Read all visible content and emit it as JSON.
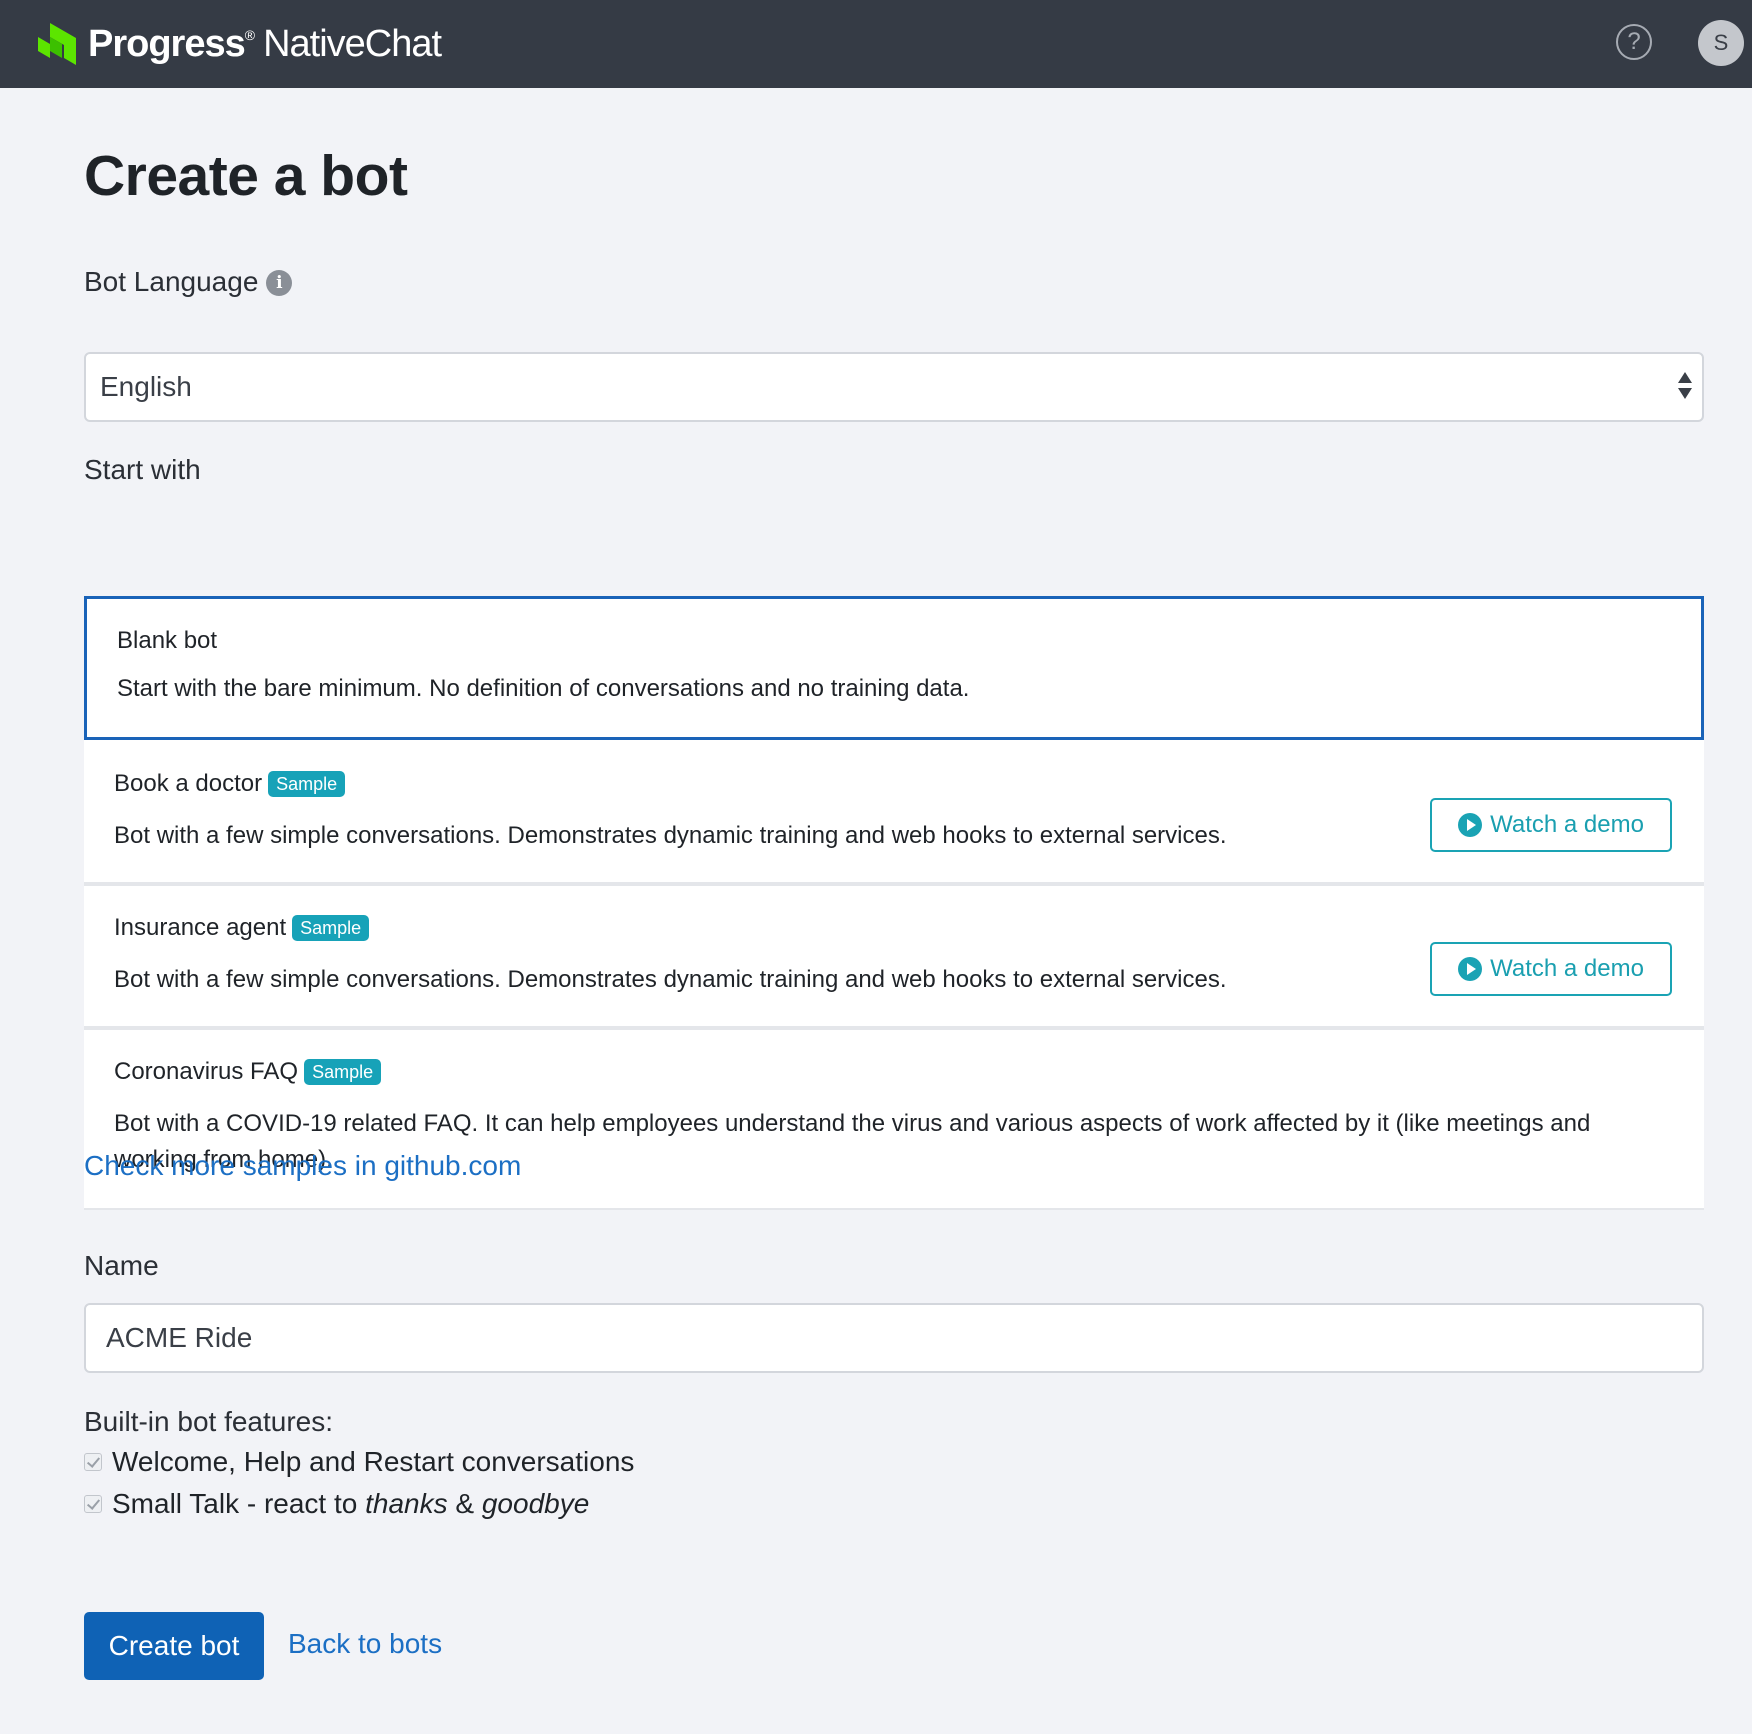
{
  "header": {
    "brand": "Progress",
    "brand_mark": "®",
    "product": "NativeChat",
    "help_glyph": "?",
    "avatar_initial": "S",
    "icons": {
      "logo": "progress-chevron-logo",
      "help": "question-circle-icon",
      "avatar": "user-avatar"
    },
    "colors": {
      "bar": "#353b45",
      "logo_green": "#5ce500"
    }
  },
  "page": {
    "title": "Create a bot"
  },
  "language": {
    "label": "Bot Language",
    "info_glyph": "i",
    "selected": "English"
  },
  "start_with": {
    "label": "Start with",
    "options": [
      {
        "title": "Blank bot",
        "description": "Start with the bare minimum. No definition of conversations and no training data.",
        "selected": true
      },
      {
        "title": "Book a doctor",
        "badge": "Sample",
        "description": "Bot with a few simple conversations. Demonstrates dynamic training and web hooks to external services.",
        "demo_label": "Watch a demo"
      },
      {
        "title": "Insurance agent",
        "badge": "Sample",
        "description": "Bot with a few simple conversations. Demonstrates dynamic training and web hooks to external services.",
        "demo_label": "Watch a demo"
      },
      {
        "title": "Coronavirus FAQ",
        "badge": "Sample",
        "description": "Bot with a COVID-19 related FAQ. It can help employees understand the virus and various aspects of work affected by it (like meetings and working from home)."
      }
    ],
    "more_link": "Check more samples in github.com"
  },
  "name_field": {
    "label": "Name",
    "value": "ACME Ride"
  },
  "features": {
    "label": "Built-in bot features:",
    "items": [
      {
        "text": "Welcome, Help and Restart conversations",
        "checked": true
      },
      {
        "parts": [
          "Small Talk - react to ",
          "thanks",
          " & ",
          "goodbye"
        ],
        "checked": true
      }
    ]
  },
  "actions": {
    "create_label": "Create bot",
    "back_label": "Back to bots"
  },
  "colors": {
    "selected_border": "#1a63b8",
    "badge": "#17a2b8",
    "link": "#1c6fc4",
    "primary_button": "#0f62b5"
  }
}
